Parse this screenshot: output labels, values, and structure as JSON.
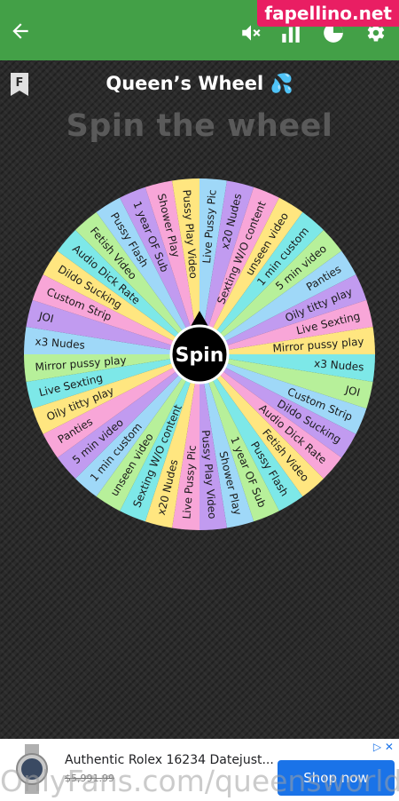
{
  "watermark_site": "fapellino.net",
  "header": {
    "title": "Queen’s Wheel",
    "title_emoji": "💦",
    "subtitle": "Spin the wheel"
  },
  "toolbar": {
    "icons": [
      "back-arrow-icon",
      "mute-icon",
      "bar-chart-icon",
      "pie-chart-icon",
      "settings-icon"
    ],
    "accent_color": "#43a047"
  },
  "wheel": {
    "spin_label": "Spin",
    "segments": [
      "Live Pussy Pic",
      "x20 Nudes",
      "Sexting W/O content",
      "unseen video",
      "1 min custom",
      "5 min video",
      "Panties",
      "Oily titty play",
      "Live Sexting",
      "Mirror pussy play",
      "x3 Nudes",
      "JOI",
      "Custom Strip",
      "Dildo Sucking",
      "Audio Dick Rate",
      "Fetish Video",
      "Pussy Flash",
      "1 year OF Sub",
      "Shower Play",
      "Pussy Play Video",
      "Live Pussy Pic",
      "x20 Nudes",
      "Sexting W/O content",
      "unseen video",
      "1 min custom",
      "5 min video",
      "Panties",
      "Oily titty play",
      "Live Sexting",
      "Mirror pussy play",
      "x3 Nudes",
      "JOI",
      "Custom Strip",
      "Dildo Sucking",
      "Audio Dick Rate",
      "Fetish Video",
      "Pussy Flash",
      "1 year OF Sub",
      "Shower Play",
      "Pussy Play Video"
    ],
    "colors": [
      "#9fd8f8",
      "#c19bf0",
      "#f8a6d8",
      "#ffe680",
      "#7de8e8",
      "#b7f09a"
    ]
  },
  "ad": {
    "headline": "Authentic Rolex 16234 Datejust...",
    "price": "$5,991.99",
    "cta": "Shop now",
    "adchoices": "▷ ✕"
  },
  "overlay_watermark": "OnlyFans.com/queensworld"
}
